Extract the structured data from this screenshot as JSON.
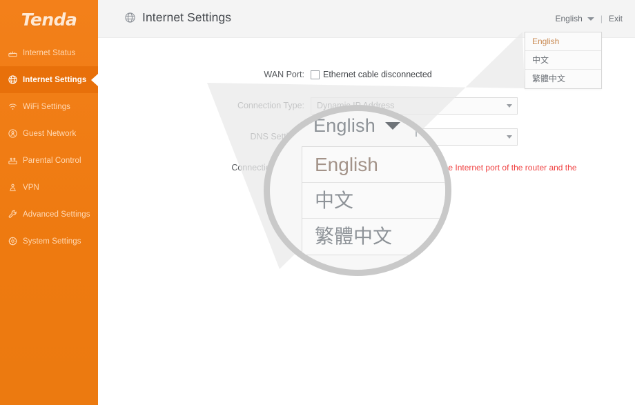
{
  "brand": {
    "logo_text": "Tenda"
  },
  "sidebar": {
    "items": [
      {
        "label": "Internet Status",
        "icon": "router-icon",
        "active": false
      },
      {
        "label": "Internet Settings",
        "icon": "globe-icon",
        "active": true
      },
      {
        "label": "WiFi Settings",
        "icon": "wifi-icon",
        "active": false
      },
      {
        "label": "Guest Network",
        "icon": "guest-network-icon",
        "active": false
      },
      {
        "label": "Parental Control",
        "icon": "parental-control-icon",
        "active": false
      },
      {
        "label": "VPN",
        "icon": "vpn-icon",
        "active": false
      },
      {
        "label": "Advanced Settings",
        "icon": "wrench-icon",
        "active": false
      },
      {
        "label": "System Settings",
        "icon": "gear-icon",
        "active": false
      }
    ]
  },
  "header": {
    "title": "Internet Settings",
    "title_icon": "globe-icon",
    "language_current": "English",
    "language_caret_icon": "chevron-down-icon",
    "separator": "|",
    "exit_label": "Exit"
  },
  "language_menu": {
    "open": true,
    "options": [
      {
        "label": "English",
        "selected": true
      },
      {
        "label": "中文",
        "selected": false
      },
      {
        "label": "繁體中文",
        "selected": false
      }
    ]
  },
  "form": {
    "rows": [
      {
        "label": "WAN Port:",
        "type": "status",
        "icon": "ethernet-port-icon",
        "value": "Ethernet cable disconnected"
      },
      {
        "label": "Connection Type:",
        "type": "select",
        "value": "Dynamic IP Address",
        "caret_icon": "chevron-down-icon"
      },
      {
        "label": "DNS Settings:",
        "type": "select",
        "value": "",
        "caret_icon": "chevron-down-icon"
      },
      {
        "label": "Connection Status:",
        "type": "hint",
        "value": "een the Internet port of the router and the"
      }
    ]
  },
  "magnifier": {
    "visible": true,
    "current_label": "English",
    "caret_icon": "chevron-down-icon",
    "options": [
      {
        "label": "English",
        "selected": true
      },
      {
        "label": "中文",
        "selected": false
      },
      {
        "label": "繁體中文",
        "selected": false
      }
    ]
  },
  "colors": {
    "brand_orange": "#f07c12",
    "active_orange": "#e8700a",
    "topbar_gray": "#f4f4f4",
    "hint_red": "#ef3f3f",
    "magnifier_ring": "#c9c9c9"
  }
}
